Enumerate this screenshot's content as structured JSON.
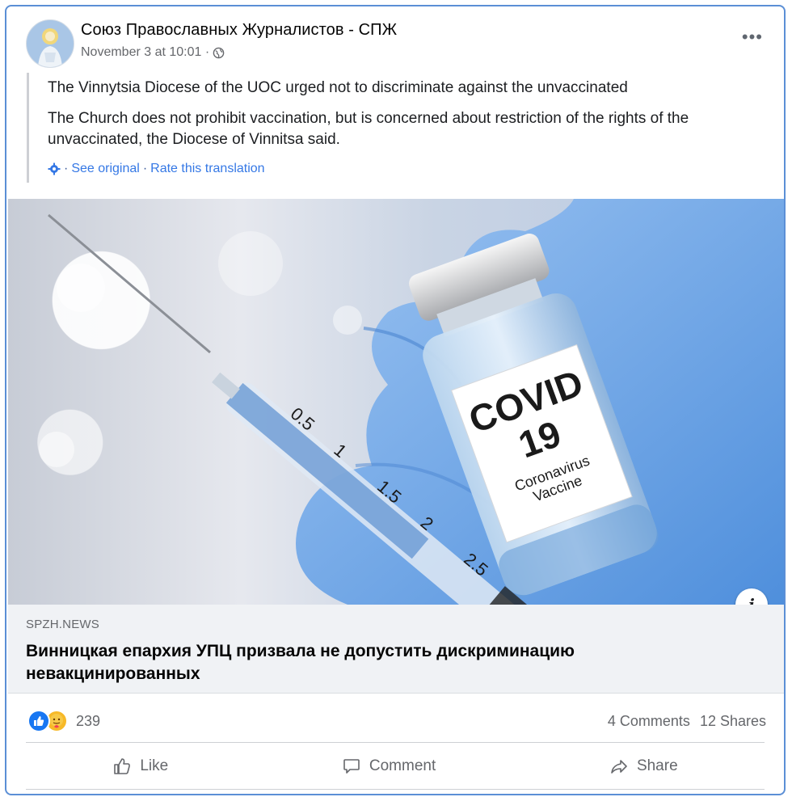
{
  "post": {
    "author": "Союз Православных Журналистов - СПЖ",
    "timestamp": "November 3 at 10:01 ·",
    "privacy_icon": "globe-icon",
    "more_label": "•••"
  },
  "translation": {
    "title": "The Vinnytsia Diocese of the UOC urged not to discriminate against the unvaccinated",
    "body": "The Church does not prohibit vaccination, but is concerned about restriction of the rights of the unvaccinated, the Diocese of Vinnitsa said.",
    "separator1": "·",
    "see_original": "See original",
    "separator2": "·",
    "rate": "Rate this translation"
  },
  "image": {
    "label_line1": "COVID",
    "label_line2": "19",
    "label_line3": "Coronavirus",
    "label_line4": "Vaccine",
    "syringe_marks": [
      "0.5",
      "1",
      "1.5",
      "2",
      "2.5"
    ]
  },
  "link_preview": {
    "domain": "SPZH.NEWS",
    "headline": "Винницкая епархия УПЦ призвала не допустить дискриминацию невакцинированных",
    "info_label": "i"
  },
  "stats": {
    "reaction_count": "239",
    "comments": "4 Comments",
    "shares": "12 Shares"
  },
  "actions": {
    "like": "Like",
    "comment": "Comment",
    "share": "Share"
  },
  "colors": {
    "accent_blue": "#1877f2",
    "link_blue": "#3578e5",
    "card_border": "#5b8fd6",
    "glove_blue": "#7fb0ea"
  }
}
